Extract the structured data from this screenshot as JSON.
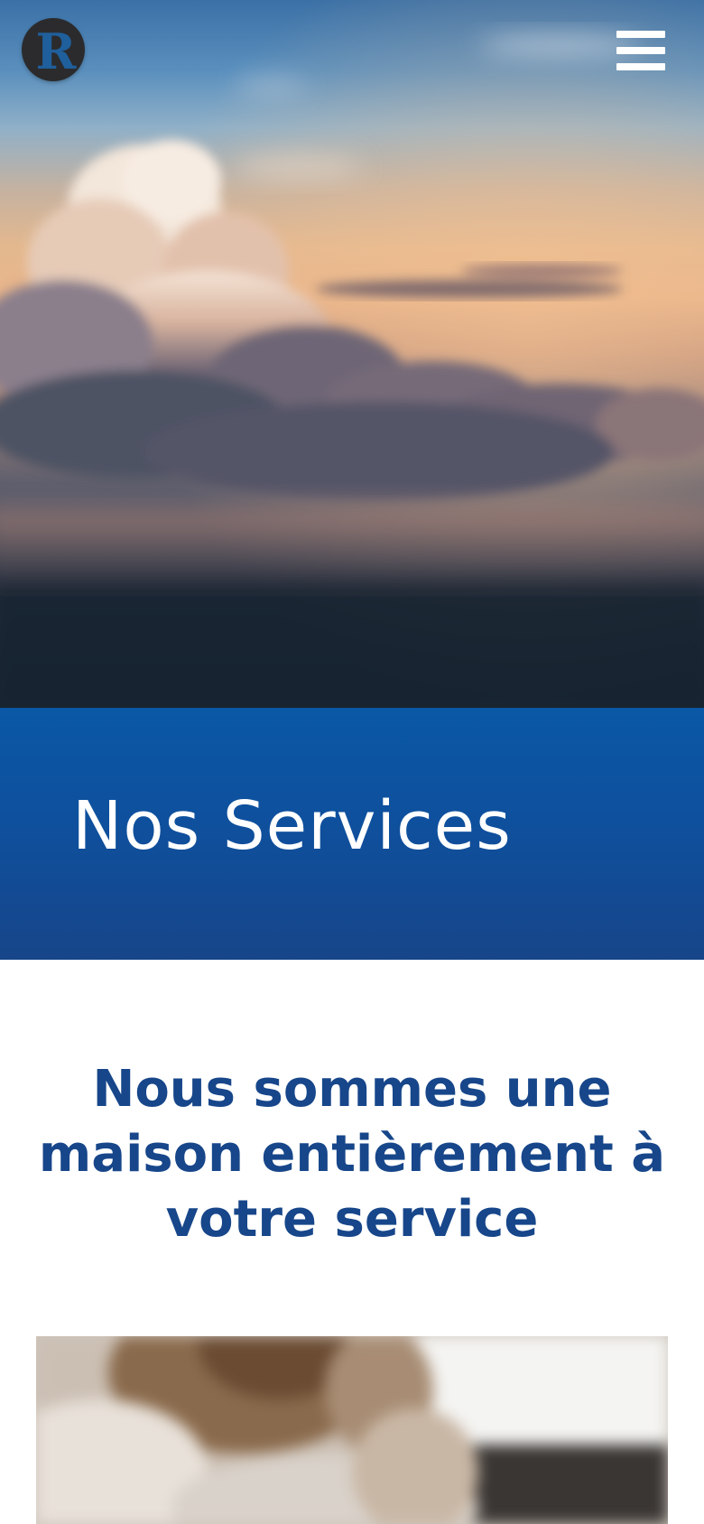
{
  "header": {
    "logo_letter": "R",
    "menu_icon": "hamburger-menu-icon"
  },
  "hero": {
    "image_subject": "cloud-sky-sunset-photo"
  },
  "banner": {
    "title": "Nos Services"
  },
  "intro": {
    "heading": "Nous sommes une maison entièrement à votre service"
  },
  "photo": {
    "image_subject": "blurred-person-photo"
  },
  "colors": {
    "band_blue": "#0f4f9c",
    "heading_blue": "#17468a",
    "logo_dark": "#2b2b2d",
    "logo_letter": "#1f5f9c",
    "white": "#ffffff"
  }
}
